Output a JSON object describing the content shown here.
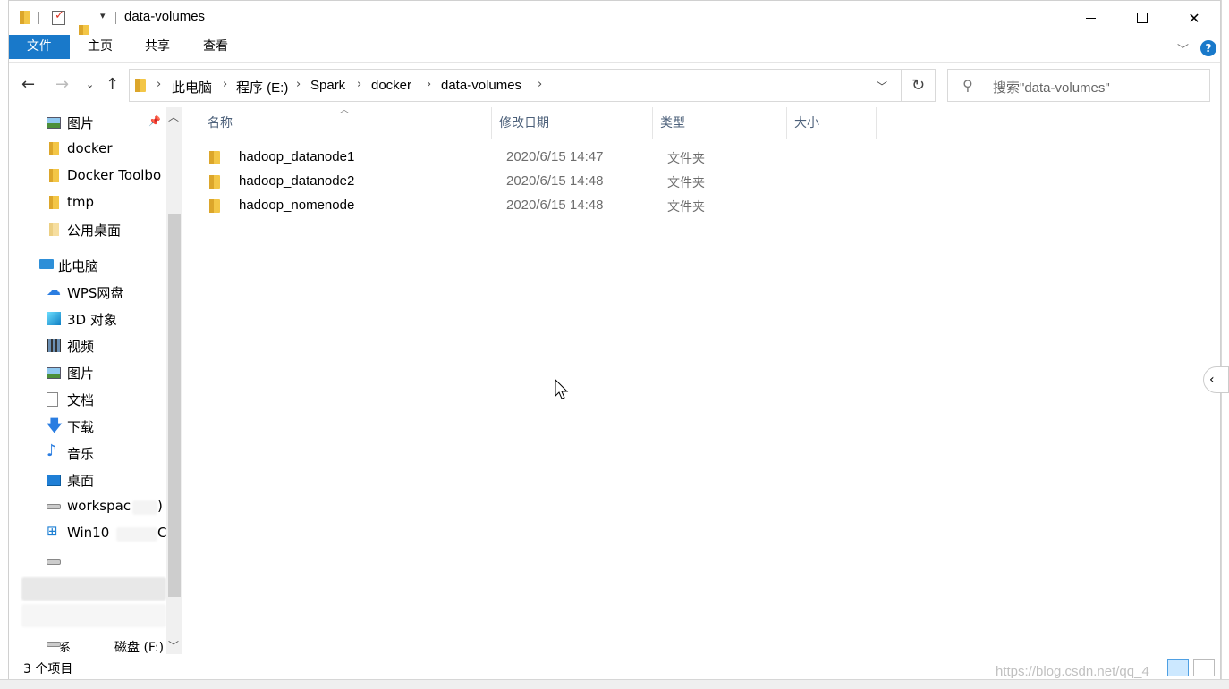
{
  "window": {
    "title": "data-volumes"
  },
  "ribbon": {
    "tabs": [
      "文件",
      "主页",
      "共享",
      "查看"
    ],
    "help": "?"
  },
  "address": {
    "crumbs": [
      "此电脑",
      "程序 (E:)",
      "Spark",
      "docker",
      "data-volumes"
    ]
  },
  "search": {
    "placeholder": "搜索\"data-volumes\""
  },
  "navpane": {
    "items": [
      {
        "label": "图片",
        "icon": "pictures-icon",
        "pinned": true
      },
      {
        "label": "docker",
        "icon": "folder-icon"
      },
      {
        "label": "Docker Toolbo",
        "icon": "folder-icon"
      },
      {
        "label": "tmp",
        "icon": "folder-icon"
      },
      {
        "label": "公用桌面",
        "icon": "folder-icon"
      },
      {
        "label": "此电脑",
        "icon": "this-pc-icon"
      },
      {
        "label": "WPS网盘",
        "icon": "cloud-icon"
      },
      {
        "label": "3D 对象",
        "icon": "3d-objects-icon"
      },
      {
        "label": "视频",
        "icon": "video-icon"
      },
      {
        "label": "图片",
        "icon": "pictures-icon"
      },
      {
        "label": "文档",
        "icon": "documents-icon"
      },
      {
        "label": "下载",
        "icon": "downloads-icon"
      },
      {
        "label": "音乐",
        "icon": "music-icon"
      },
      {
        "label": "桌面",
        "icon": "desktop-icon"
      },
      {
        "label": "workspac",
        "suffix": ")",
        "icon": "drive-icon"
      },
      {
        "label": "Win10",
        "suffix": "C",
        "icon": "windows-drive-icon"
      },
      {
        "label": "",
        "icon": "drive-icon"
      },
      {
        "label": "",
        "icon": "drive-icon"
      },
      {
        "label": "",
        "icon": "drive-icon"
      },
      {
        "label": "",
        "prefix": "系",
        "suffix": "磁盘 (F:)",
        "icon": "drive-icon"
      }
    ]
  },
  "filelist": {
    "columns": [
      "名称",
      "修改日期",
      "类型",
      "大小"
    ],
    "rows": [
      {
        "name": "hadoop_datanode1",
        "date": "2020/6/15 14:47",
        "type": "文件夹"
      },
      {
        "name": "hadoop_datanode2",
        "date": "2020/6/15 14:48",
        "type": "文件夹"
      },
      {
        "name": "hadoop_nomenode",
        "date": "2020/6/15 14:48",
        "type": "文件夹"
      }
    ]
  },
  "status": {
    "count": "3 个项目"
  },
  "watermark": "https://blog.csdn.net/qq_4"
}
